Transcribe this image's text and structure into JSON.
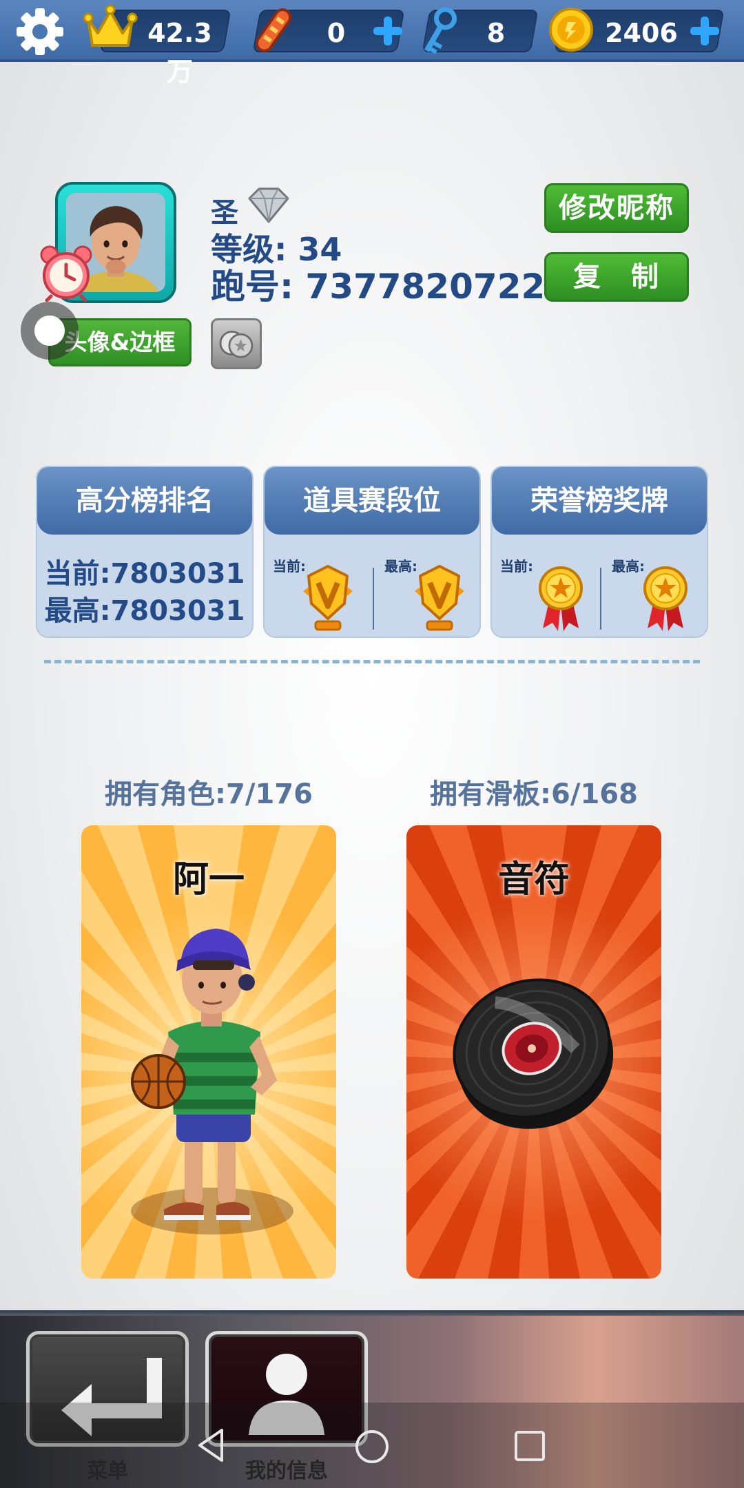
{
  "topbar": {
    "score": "42.3万",
    "boards": "0",
    "keys": "8",
    "coins": "2406"
  },
  "profile": {
    "avatar_button": "头像&边框",
    "name": "圣",
    "level": "等级: 34",
    "run_id": "跑号: 7377820722",
    "rename_button": "修改昵称",
    "copy_button": "复　制"
  },
  "cards": {
    "highscore": {
      "title": "高分榜排名",
      "current": "当前:7803031",
      "best": "最高:7803031"
    },
    "powerup": {
      "title": "道具赛段位",
      "current_label": "当前:",
      "best_label": "最高:"
    },
    "honor": {
      "title": "荣誉榜奖牌",
      "current_label": "当前:",
      "best_label": "最高:"
    }
  },
  "owned": {
    "characters_label": "拥有角色:7/176",
    "boards_label": "拥有滑板:6/168",
    "character_name": "阿一",
    "board_name": "音符"
  },
  "bottom_nav": {
    "menu_label": "菜单",
    "myinfo_label": "我的信息"
  },
  "colors": {
    "topbar_blue": "#4a76b2",
    "title_blue": "#244a86",
    "button_green": "#3fa52d",
    "card_orange": "#ffb63e",
    "card_red": "#d9400e"
  }
}
